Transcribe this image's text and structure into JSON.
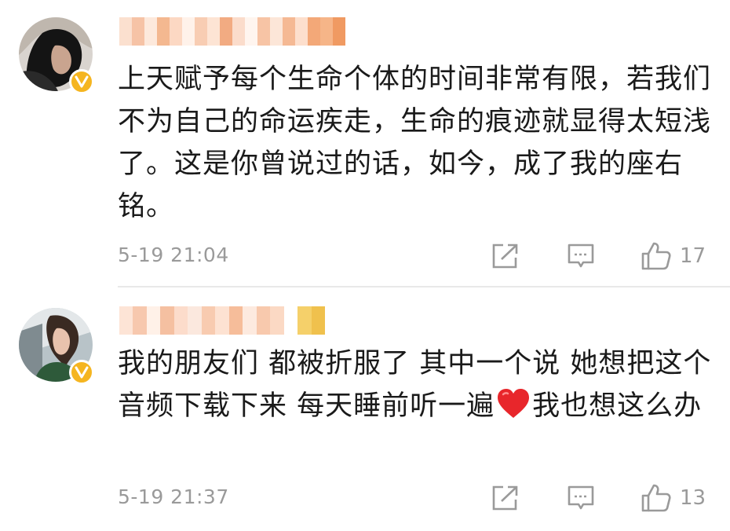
{
  "comments": [
    {
      "user_verified_icon": "verified-v-badge-icon",
      "text": "上天赋予每个生命个体的时间非常有限，若我们不为自己的命运疾走，生命的痕迹就显得太短浅了。这是你曾说过的话，如今，成了我的座右铭。",
      "time": "5-19 21:04",
      "likes": "17"
    },
    {
      "user_verified_icon": "verified-v-badge-icon",
      "text_before_emoji": "我的朋友们 都被折服了 其中一个说 她想把这个音频下载下来 每天睡前听一遍",
      "emoji": "red-heart-icon",
      "text_after_emoji": "我也想这么办",
      "time": "5-19 21:37",
      "likes": "13"
    }
  ],
  "icons": {
    "share": "share-icon",
    "reply": "comment-icon",
    "like": "thumbs-up-icon"
  },
  "colors": {
    "verified_badge": "#f5b520",
    "meta_text": "#9a9a9a",
    "heart": "#e8262b"
  }
}
